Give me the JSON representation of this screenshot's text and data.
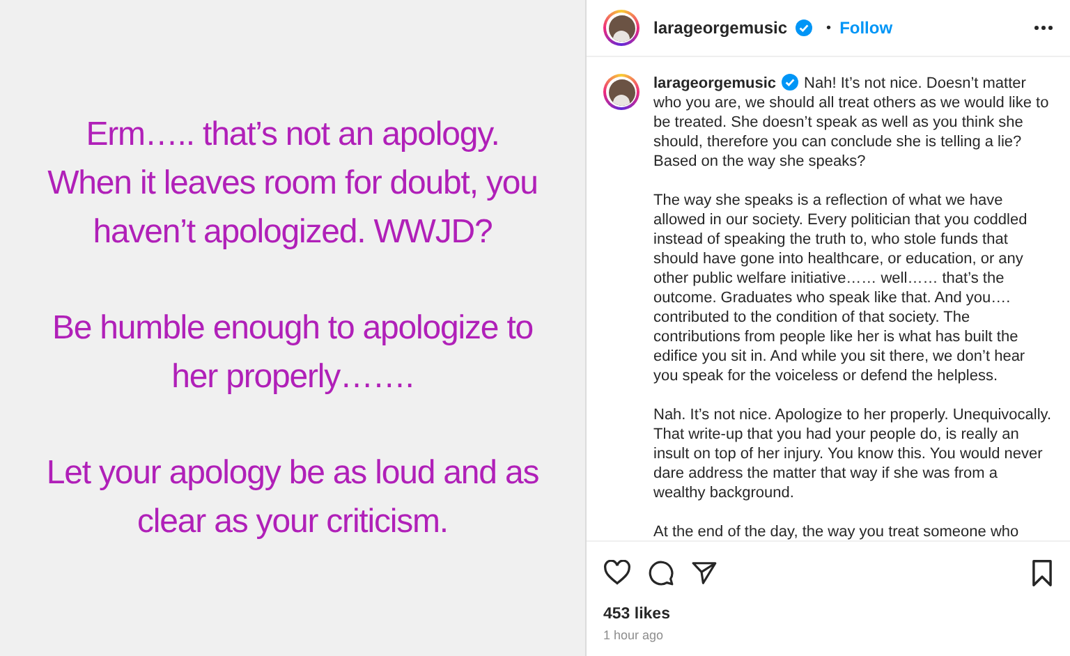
{
  "post_image": {
    "paragraphs": [
      "Erm….. that’s not an apology. When it leaves room for doubt, you haven’t apologized. WWJD?",
      "Be humble enough to apologize to her properly…….",
      "Let your apology be as loud and as clear as your criticism."
    ]
  },
  "header": {
    "username": "larageorgemusic",
    "verified": true,
    "separator": "•",
    "follow": "Follow"
  },
  "caption": {
    "username": "larageorgemusic",
    "verified": true,
    "paragraphs": [
      "Nah! It’s not nice. Doesn’t matter who you are, we should all treat others as we would like to be treated. She doesn’t speak as well as you think she should, therefore you can conclude she is telling a lie? Based on the way she speaks?",
      "The way she speaks is a reflection of what we have allowed in our society. Every politician that you coddled instead of speaking the truth to, who stole funds that should have gone into healthcare, or education, or any other public welfare initiative…… well…… that’s the outcome. Graduates who speak like that. And you…. contributed to the condition of that society. The contributions from people like her is what has built the edifice you sit in. And while you sit there, we don’t hear you speak for the voiceless or defend the helpless.",
      "Nah. It’s not nice. Apologize to her properly. Unequivocally. That write-up that you had your people do, is really an insult on top of her injury. You know this. You would never dare address the matter that way if she was from a wealthy background.",
      "At the end of the day, the way you treat someone who"
    ]
  },
  "likes": "453 likes",
  "time": "1 hour ago"
}
